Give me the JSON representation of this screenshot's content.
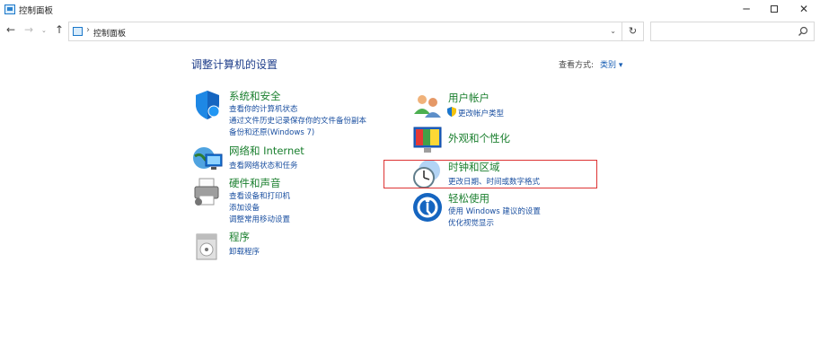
{
  "window": {
    "title": "控制面板",
    "min_glyph": "─",
    "close_glyph": "✕"
  },
  "nav": {
    "back_glyph": "←",
    "forward_glyph": "→",
    "dropdown_glyph": "⌄",
    "up_glyph": "↑",
    "breadcrumb_sep": "›",
    "address": "控制面板",
    "address_dropdown_glyph": "⌄",
    "refresh_glyph": "↻",
    "search_placeholder": ""
  },
  "main": {
    "title": "调整计算机的设置",
    "view_by_label": "查看方式:",
    "view_by_value": "类别 ▾"
  },
  "categories_left": [
    {
      "heading": "系统和安全",
      "icon": "shield-icon",
      "links": [
        "查看你的计算机状态",
        "通过文件历史记录保存你的文件备份副本",
        "备份和还原(Windows 7)"
      ]
    },
    {
      "heading": "网络和 Internet",
      "icon": "network-globe-icon",
      "links": [
        "查看网络状态和任务"
      ]
    },
    {
      "heading": "硬件和声音",
      "icon": "printer-icon",
      "links": [
        "查看设备和打印机",
        "添加设备",
        "调整常用移动设置"
      ]
    },
    {
      "heading": "程序",
      "icon": "programs-icon",
      "links": [
        "卸载程序"
      ]
    }
  ],
  "categories_right": [
    {
      "heading": "用户帐户",
      "icon": "users-icon",
      "links": [
        "更改帐户类型"
      ]
    },
    {
      "heading": "外观和个性化",
      "icon": "appearance-icon",
      "links": []
    },
    {
      "heading": "时钟和区域",
      "icon": "clock-globe-icon",
      "links": [
        "更改日期、时间或数字格式"
      ]
    },
    {
      "heading": "轻松使用",
      "icon": "ease-of-access-icon",
      "links": [
        "使用 Windows 建议的设置",
        "优化视觉显示"
      ]
    }
  ],
  "colors": {
    "heading_green": "#1a7f2e",
    "link_blue": "#1a4fa0",
    "title_blue": "#1e3d8a",
    "highlight_red": "#dd3333"
  }
}
